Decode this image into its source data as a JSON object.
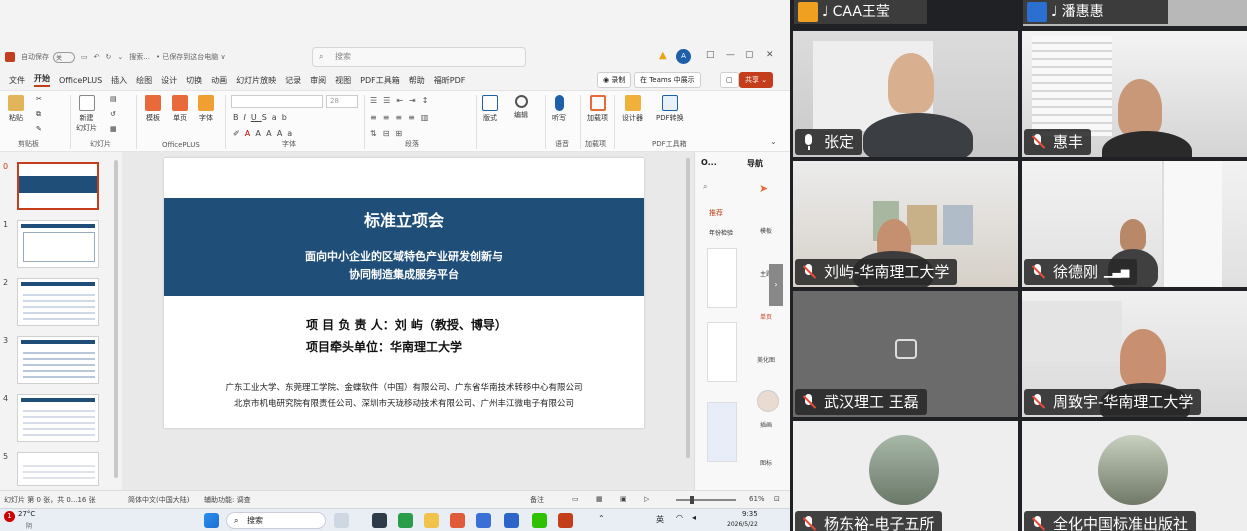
{
  "ppt": {
    "titlebar": {
      "autosave_label": "自动保存",
      "toggle_state": "关",
      "filename": "搜索...",
      "save_status": "• 已保存到这台电脑 ∨",
      "search_placeholder": "搜索",
      "account_initial": "A"
    },
    "menu": [
      "文件",
      "开始",
      "OfficePLUS",
      "插入",
      "绘图",
      "设计",
      "切换",
      "动画",
      "幻灯片放映",
      "记录",
      "审阅",
      "视图",
      "PDF工具箱",
      "帮助",
      "福昕PDF"
    ],
    "active_menu": "开始",
    "menu_right": {
      "record": "录制",
      "teams": "在 Teams 中展示",
      "share": "共享"
    },
    "ribbon": {
      "paste": "粘贴",
      "new_slide_a": "新建",
      "new_slide_b": "幻灯片",
      "template": "模板",
      "single_page": "单页",
      "font_btn": "字体",
      "font_name": "",
      "font_size": "28",
      "layout_label": "版式",
      "find": "编辑",
      "dictate": "听写",
      "addin": "加载项",
      "designer": "设计器",
      "pdf": "PDF转换",
      "groups": [
        "剪贴板",
        "幻灯片",
        "OfficePLUS",
        "字体",
        "段落",
        "语音",
        "加载项",
        "PDF工具箱"
      ]
    },
    "slide_numbers": [
      "0",
      "1",
      "2",
      "3",
      "4",
      "5"
    ],
    "slide": {
      "title": "标准立项会",
      "subtitle_line1": "面向中小企业的区域特色产业研发创新与",
      "subtitle_line2": "协同制造集成服务平台",
      "leader": "项 目 负 责 人：刘 屿（教授、博导）",
      "unit": "项目牵头单位：华南理工大学",
      "orgs_line1": "广东工业大学、东莞理工学院、金蝶软件（中国）有限公司、广东省华南技术转移中心有限公司",
      "orgs_line2": "北京市机电研究院有限责任公司、深圳市天珑移动技术有限公司、广州丰江微电子有限公司"
    },
    "side_pane": {
      "header_o": "O...",
      "header_nav": "导航",
      "tab_recommend": "推荐",
      "tab_year": "年份检验",
      "nav_items": [
        "模板",
        "主题",
        "单页",
        "美化图",
        "资源",
        "插画",
        "图标"
      ]
    },
    "status": {
      "slide_info": "幻灯片 第 0 张，共 0...16 张",
      "language": "简体中文(中国大陆)",
      "accessibility": "辅助功能: 调查",
      "notes": "备注",
      "zoom": "61%"
    },
    "taskbar": {
      "weather_temp": "27°C",
      "weather_desc": "阴",
      "search": "搜索",
      "ime": "英",
      "time": "9:35",
      "date": "2026/5/22",
      "badge": "1"
    }
  },
  "meeting": {
    "top_names": [
      "CAA王莹",
      "潘惠惠"
    ],
    "participants": [
      {
        "name": "张定",
        "muted": false
      },
      {
        "name": "惠丰",
        "muted": true
      },
      {
        "name": "刘屿-华南理工大学",
        "muted": true
      },
      {
        "name": "徐德刚",
        "muted": true
      },
      {
        "name": "武汉理工 王磊",
        "muted": true
      },
      {
        "name": "周致宇-华南理工大学",
        "muted": true
      },
      {
        "name": "杨东裕-电子五所",
        "muted": true
      },
      {
        "name": "全化中国标准出版社",
        "muted": true
      }
    ]
  }
}
